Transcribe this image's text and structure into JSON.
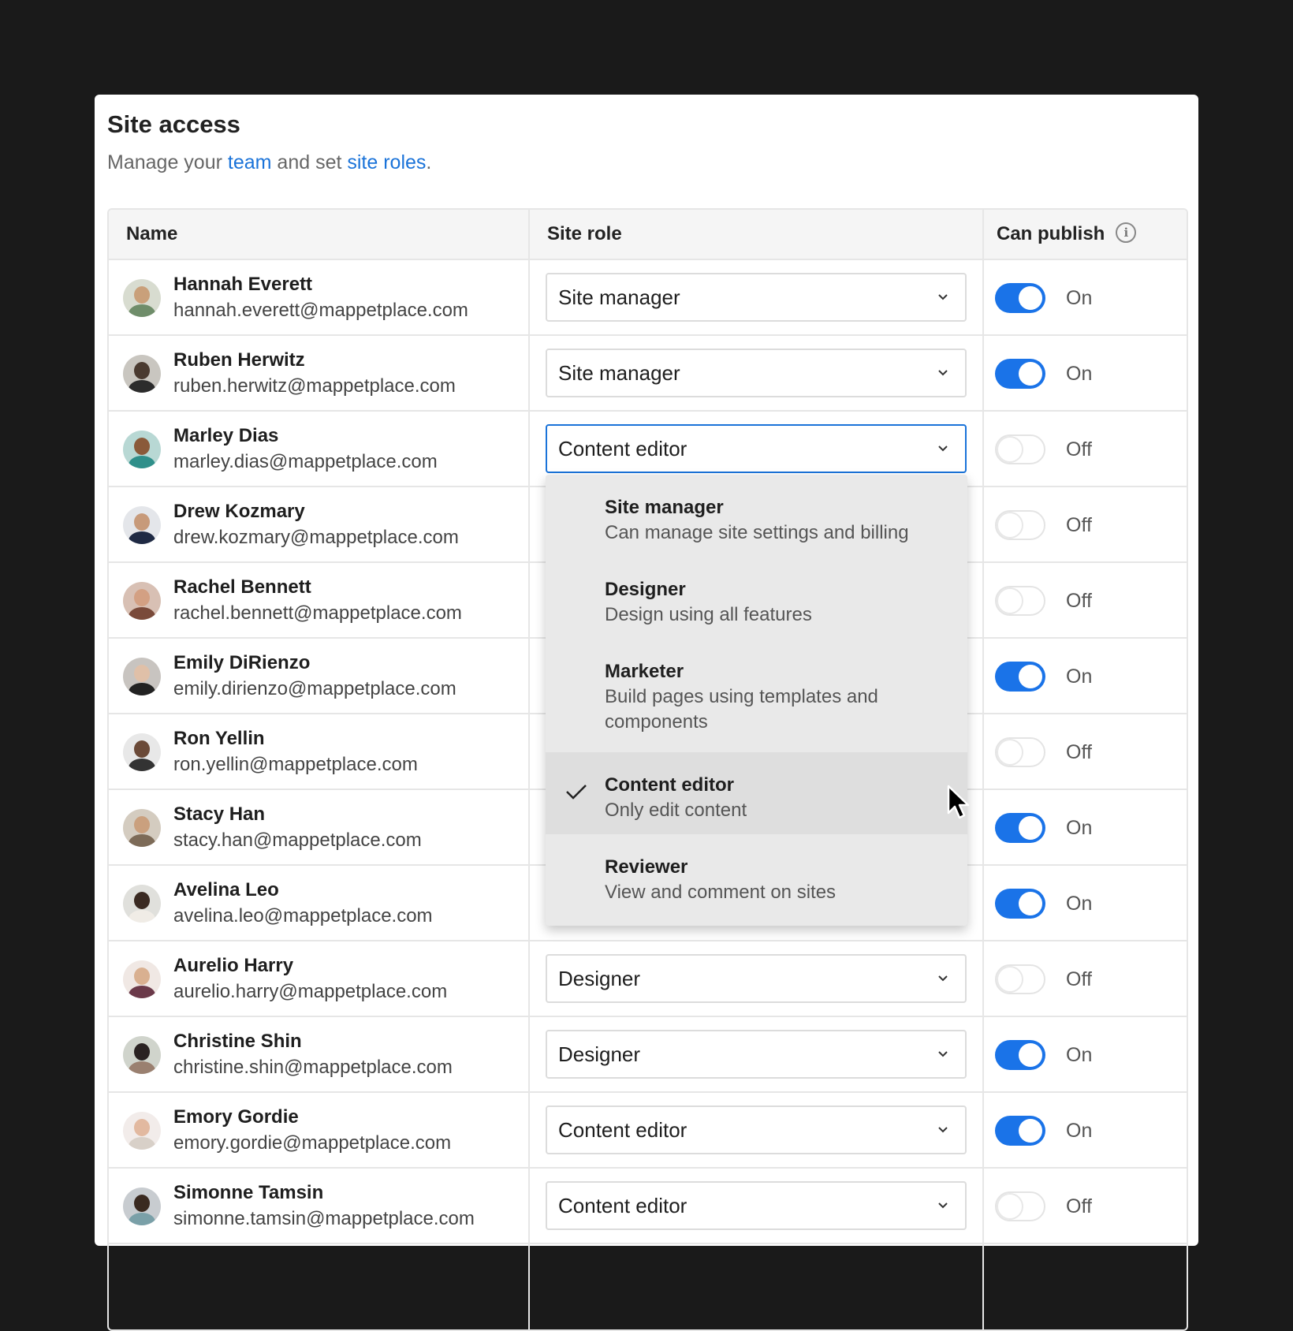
{
  "panel": {
    "title": "Site access",
    "subtitle_prefix": "Manage your ",
    "subtitle_link1": "team",
    "subtitle_mid": " and set ",
    "subtitle_link2": "site roles",
    "subtitle_suffix": "."
  },
  "table": {
    "headers": {
      "name": "Name",
      "role": "Site role",
      "publish": "Can publish"
    },
    "rows": [
      {
        "name": "Hannah Everett",
        "email": "hannah.everett@mappetplace.com",
        "role": "Site manager",
        "publish": "On"
      },
      {
        "name": "Ruben Herwitz",
        "email": "ruben.herwitz@mappetplace.com",
        "role": "Site manager",
        "publish": "On"
      },
      {
        "name": "Marley Dias",
        "email": "marley.dias@mappetplace.com",
        "role": "Content editor",
        "publish": "Off"
      },
      {
        "name": "Drew Kozmary",
        "email": "drew.kozmary@mappetplace.com",
        "role": "",
        "publish": "Off"
      },
      {
        "name": "Rachel Bennett",
        "email": "rachel.bennett@mappetplace.com",
        "role": "",
        "publish": "Off"
      },
      {
        "name": "Emily DiRienzo",
        "email": "emily.dirienzo@mappetplace.com",
        "role": "",
        "publish": "On"
      },
      {
        "name": "Ron Yellin",
        "email": "ron.yellin@mappetplace.com",
        "role": "",
        "publish": "Off"
      },
      {
        "name": "Stacy Han",
        "email": "stacy.han@mappetplace.com",
        "role": "",
        "publish": "On"
      },
      {
        "name": "Avelina Leo",
        "email": "avelina.leo@mappetplace.com",
        "role": "",
        "publish": "On"
      },
      {
        "name": "Aurelio Harry",
        "email": "aurelio.harry@mappetplace.com",
        "role": "Designer",
        "publish": "Off"
      },
      {
        "name": "Christine Shin",
        "email": "christine.shin@mappetplace.com",
        "role": "Designer",
        "publish": "On"
      },
      {
        "name": "Emory Gordie",
        "email": "emory.gordie@mappetplace.com",
        "role": "Content editor",
        "publish": "On"
      },
      {
        "name": "Simonne Tamsin",
        "email": "simonne.tamsin@mappetplace.com",
        "role": "Content editor",
        "publish": "Off"
      }
    ]
  },
  "dropdown": {
    "selected": "Content editor",
    "options": [
      {
        "name": "Site manager",
        "desc": "Can manage site settings and billing"
      },
      {
        "name": "Designer",
        "desc": "Design using all features"
      },
      {
        "name": "Marketer",
        "desc": "Build pages using templates and components"
      },
      {
        "name": "Content editor",
        "desc": "Only edit content"
      },
      {
        "name": "Reviewer",
        "desc": "View and comment on sites"
      }
    ]
  },
  "colors": {
    "accent": "#1a73e8",
    "link": "#1a73d9",
    "background": "#1a1a1a"
  },
  "icons": {
    "info": "info-icon",
    "chevron": "chevron-down-icon",
    "check": "check-icon",
    "cursor": "mouse-pointer-icon"
  }
}
